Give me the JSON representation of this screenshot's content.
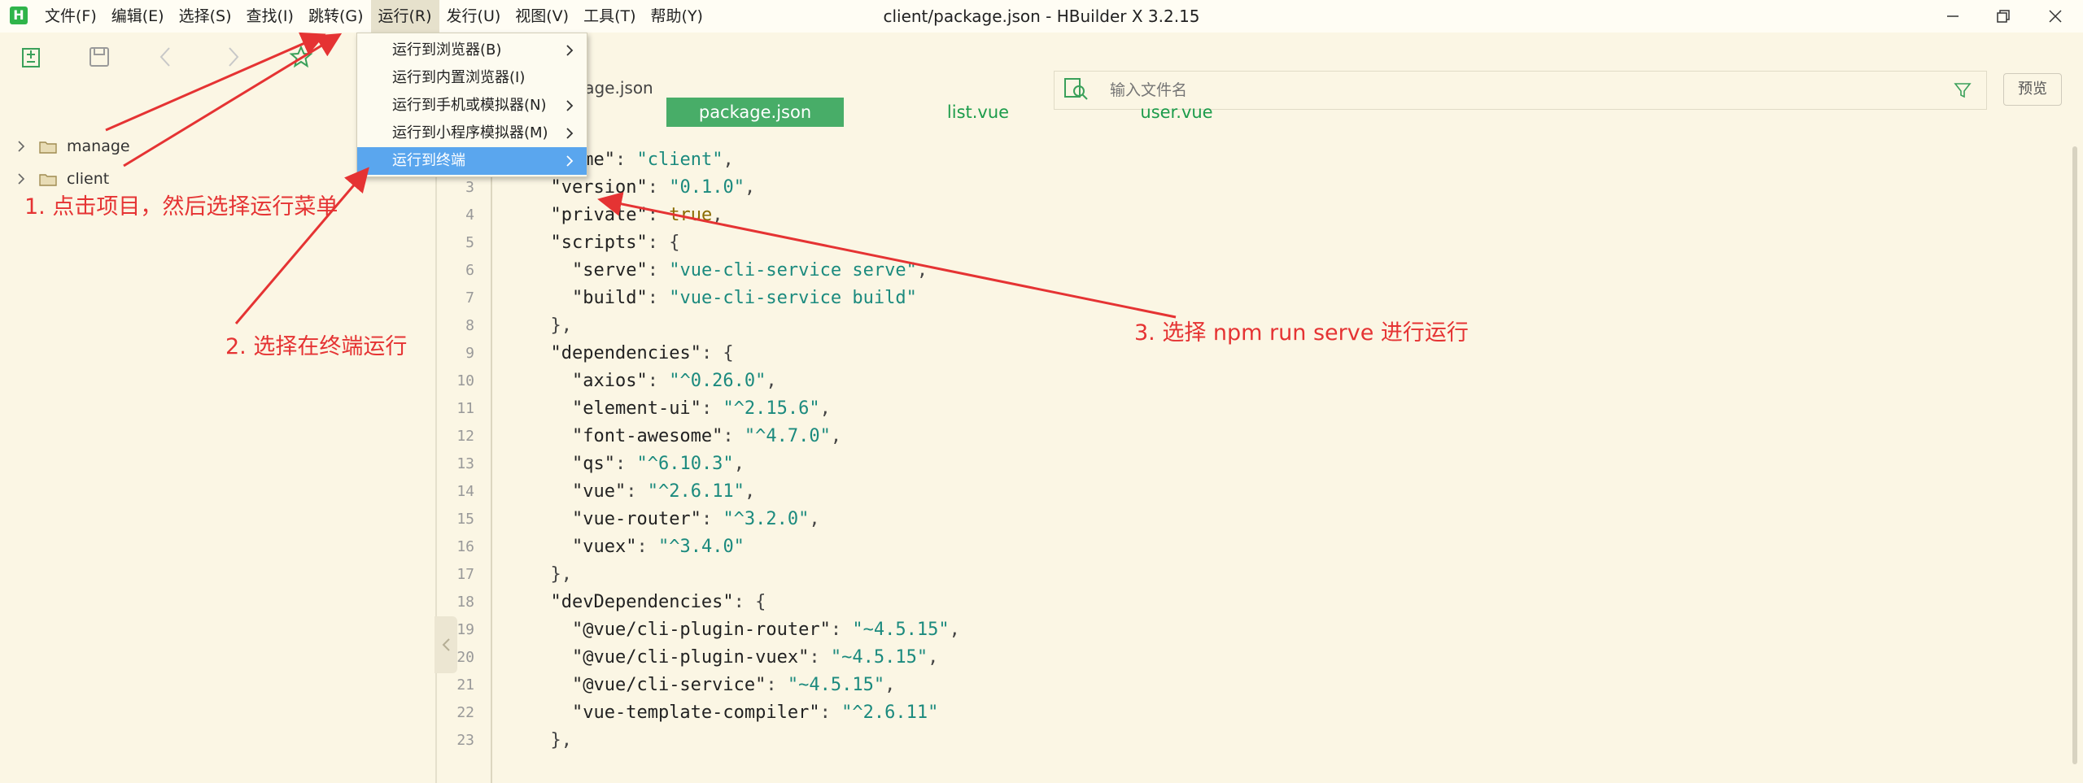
{
  "window": {
    "title": "client/package.json - HBuilder X 3.2.15",
    "logo": "H",
    "buttons": [
      "minimize-icon",
      "restore-icon",
      "close-icon"
    ]
  },
  "menu": [
    {
      "label": "文件(F)",
      "active": false
    },
    {
      "label": "编辑(E)",
      "active": false
    },
    {
      "label": "选择(S)",
      "active": false
    },
    {
      "label": "查找(I)",
      "active": false
    },
    {
      "label": "跳转(G)",
      "active": false
    },
    {
      "label": "运行(R)",
      "active": true
    },
    {
      "label": "发行(U)",
      "active": false
    },
    {
      "label": "视图(V)",
      "active": false
    },
    {
      "label": "工具(T)",
      "active": false
    },
    {
      "label": "帮助(Y)",
      "active": false
    }
  ],
  "run_menu": [
    {
      "label": "运行到浏览器(B)",
      "has_submenu": true,
      "highlighted": false
    },
    {
      "label": "运行到内置浏览器(I)",
      "has_submenu": false,
      "highlighted": false
    },
    {
      "label": "运行到手机或模拟器(N)",
      "has_submenu": true,
      "highlighted": false
    },
    {
      "label": "运行到小程序模拟器(M)",
      "has_submenu": true,
      "highlighted": false
    },
    {
      "label": "运行到终端",
      "has_submenu": true,
      "highlighted": true
    }
  ],
  "toolbar": {
    "path_fragment": "kage.json",
    "icons": [
      "new-file-icon",
      "save-icon",
      "back-icon",
      "forward-icon",
      "bookmark-icon"
    ],
    "search_placeholder": "输入文件名",
    "preview_label": "预览"
  },
  "sidebar": {
    "items": [
      {
        "label": "manage"
      },
      {
        "label": "client"
      }
    ]
  },
  "tabs": [
    {
      "label": "package.json",
      "active": true
    },
    {
      "label": "list.vue",
      "active": false
    },
    {
      "label": "user.vue",
      "active": false
    }
  ],
  "editor": {
    "line_numbers": [
      "2",
      "3",
      "4",
      "5",
      "6",
      "7",
      "8",
      "9",
      "10",
      "11",
      "12",
      "13",
      "14",
      "15",
      "16",
      "17",
      "18",
      "19",
      "20",
      "21",
      "22",
      "23"
    ],
    "lines": [
      [
        [
          "  ",
          "p"
        ],
        [
          "\"name\"",
          "k"
        ],
        [
          ": ",
          "p"
        ],
        [
          "\"client\"",
          "s"
        ],
        [
          ",",
          "p"
        ]
      ],
      [
        [
          "  ",
          "p"
        ],
        [
          "\"version\"",
          "k"
        ],
        [
          ": ",
          "p"
        ],
        [
          "\"0.1.0\"",
          "s"
        ],
        [
          ",",
          "p"
        ]
      ],
      [
        [
          "  ",
          "p"
        ],
        [
          "\"private\"",
          "k"
        ],
        [
          ": ",
          "p"
        ],
        [
          "true",
          "b"
        ],
        [
          ",",
          "p"
        ]
      ],
      [
        [
          "  ",
          "p"
        ],
        [
          "\"scripts\"",
          "k"
        ],
        [
          ": {",
          "p"
        ]
      ],
      [
        [
          "    ",
          "p"
        ],
        [
          "\"serve\"",
          "k"
        ],
        [
          ": ",
          "p"
        ],
        [
          "\"vue-cli-service serve\"",
          "s"
        ],
        [
          ",",
          "p"
        ]
      ],
      [
        [
          "    ",
          "p"
        ],
        [
          "\"build\"",
          "k"
        ],
        [
          ": ",
          "p"
        ],
        [
          "\"vue-cli-service build\"",
          "s"
        ]
      ],
      [
        [
          "  },",
          "p"
        ]
      ],
      [
        [
          "  ",
          "p"
        ],
        [
          "\"dependencies\"",
          "k"
        ],
        [
          ": {",
          "p"
        ]
      ],
      [
        [
          "    ",
          "p"
        ],
        [
          "\"axios\"",
          "k"
        ],
        [
          ": ",
          "p"
        ],
        [
          "\"^0.26.0\"",
          "s"
        ],
        [
          ",",
          "p"
        ]
      ],
      [
        [
          "    ",
          "p"
        ],
        [
          "\"element-ui\"",
          "k"
        ],
        [
          ": ",
          "p"
        ],
        [
          "\"^2.15.6\"",
          "s"
        ],
        [
          ",",
          "p"
        ]
      ],
      [
        [
          "    ",
          "p"
        ],
        [
          "\"font-awesome\"",
          "k"
        ],
        [
          ": ",
          "p"
        ],
        [
          "\"^4.7.0\"",
          "s"
        ],
        [
          ",",
          "p"
        ]
      ],
      [
        [
          "    ",
          "p"
        ],
        [
          "\"qs\"",
          "k"
        ],
        [
          ": ",
          "p"
        ],
        [
          "\"^6.10.3\"",
          "s"
        ],
        [
          ",",
          "p"
        ]
      ],
      [
        [
          "    ",
          "p"
        ],
        [
          "\"vue\"",
          "k"
        ],
        [
          ": ",
          "p"
        ],
        [
          "\"^2.6.11\"",
          "s"
        ],
        [
          ",",
          "p"
        ]
      ],
      [
        [
          "    ",
          "p"
        ],
        [
          "\"vue-router\"",
          "k"
        ],
        [
          ": ",
          "p"
        ],
        [
          "\"^3.2.0\"",
          "s"
        ],
        [
          ",",
          "p"
        ]
      ],
      [
        [
          "    ",
          "p"
        ],
        [
          "\"vuex\"",
          "k"
        ],
        [
          ": ",
          "p"
        ],
        [
          "\"^3.4.0\"",
          "s"
        ]
      ],
      [
        [
          "  },",
          "p"
        ]
      ],
      [
        [
          "  ",
          "p"
        ],
        [
          "\"devDependencies\"",
          "k"
        ],
        [
          ": {",
          "p"
        ]
      ],
      [
        [
          "    ",
          "p"
        ],
        [
          "\"@vue/cli-plugin-router\"",
          "k"
        ],
        [
          ": ",
          "p"
        ],
        [
          "\"~4.5.15\"",
          "s"
        ],
        [
          ",",
          "p"
        ]
      ],
      [
        [
          "    ",
          "p"
        ],
        [
          "\"@vue/cli-plugin-vuex\"",
          "k"
        ],
        [
          ": ",
          "p"
        ],
        [
          "\"~4.5.15\"",
          "s"
        ],
        [
          ",",
          "p"
        ]
      ],
      [
        [
          "    ",
          "p"
        ],
        [
          "\"@vue/cli-service\"",
          "k"
        ],
        [
          ": ",
          "p"
        ],
        [
          "\"~4.5.15\"",
          "s"
        ],
        [
          ",",
          "p"
        ]
      ],
      [
        [
          "    ",
          "p"
        ],
        [
          "\"vue-template-compiler\"",
          "k"
        ],
        [
          ": ",
          "p"
        ],
        [
          "\"^2.6.11\"",
          "s"
        ]
      ],
      [
        [
          "  },",
          "p"
        ]
      ]
    ]
  },
  "annotations": {
    "step1": "1. 点击项目，然后选择运行菜单",
    "step2": "2. 选择在终端运行",
    "step3": "3. 选择 npm  run serve 进行运行",
    "color": "#e53333"
  },
  "colors": {
    "background": "#fbf6e4",
    "tab_active": "#48ad68",
    "menu_highlight": "#5aa6ee",
    "string": "#1b8a7e"
  }
}
